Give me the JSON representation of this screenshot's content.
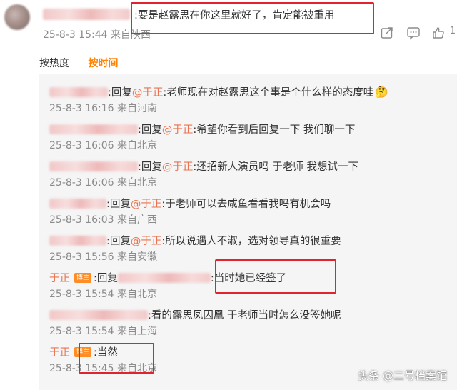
{
  "comment": {
    "text": ":要是赵露思在你这里就好了，肯定能被重用",
    "meta": "25-8-3 15:44 来自陕西",
    "icons": [
      "share-icon",
      "comment-icon",
      "like-icon"
    ],
    "like_count": "1"
  },
  "sort_tabs": {
    "hot": "按热度",
    "time": "按时间",
    "active": "time"
  },
  "replies": [
    {
      "text": ":回复",
      "mention": "@于正",
      "content": ":老师现在对赵露思这个事是个什么样的态度哇",
      "emoji": "🤔",
      "meta": "25-8-3 16:16 来自河南"
    },
    {
      "text": ":回复",
      "mention": "@于正",
      "content": ":希望你看到后回复一下  我们聊一下",
      "meta": "25-8-3 16:06 来自北京"
    },
    {
      "text": ":回复",
      "mention": "@于正",
      "content": ":还招新人演员吗  于老师 我想试一下",
      "meta": "25-8-3 16:06 来自北京"
    },
    {
      "text": ":回复",
      "mention": "@于正",
      "content": ":于老师可以去咸鱼看看我吗有机会吗",
      "meta": "25-8-3 16:03 来自广西"
    },
    {
      "text": ":回复",
      "mention": "@于正",
      "content": ":所以说遇人不淑，选对领导真的很重要",
      "meta": "25-8-3 15:56 来自安徽"
    },
    {
      "author": "于正",
      "badge": "博主",
      "text": ":回复",
      "content": ":当时她已经签了",
      "meta": "25-8-3 15:54 来自北京"
    },
    {
      "content": ":看的露思凤囚凰  于老师当时怎么没签她呢",
      "meta": "25-8-3 15:54 来自上海"
    },
    {
      "author": "于正",
      "badge": "博主",
      "content": ":当然",
      "meta": "25-8-3 15:45 来自北京"
    }
  ],
  "watermark": "头条 @二号档案馆",
  "colors": {
    "accent_orange": "#ff8200",
    "link": "#eb7350",
    "highlight_box": "#e0232c"
  }
}
